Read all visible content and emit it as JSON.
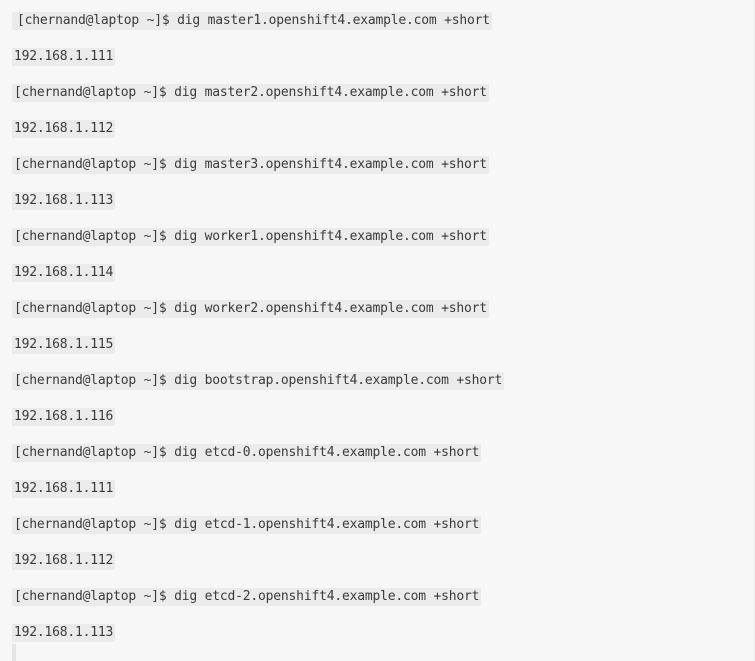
{
  "terminal": {
    "lines": [
      "[chernand@laptop ~]$ dig master1.openshift4.example.com +short",
      "192.168.1.111",
      "[chernand@laptop ~]$ dig master2.openshift4.example.com +short",
      "192.168.1.112",
      "[chernand@laptop ~]$ dig master3.openshift4.example.com +short",
      "192.168.1.113",
      "[chernand@laptop ~]$ dig worker1.openshift4.example.com +short",
      "192.168.1.114",
      "[chernand@laptop ~]$ dig worker2.openshift4.example.com +short",
      "192.168.1.115",
      "[chernand@laptop ~]$ dig bootstrap.openshift4.example.com +short",
      "192.168.1.116",
      "[chernand@laptop ~]$ dig etcd-0.openshift4.example.com +short",
      "192.168.1.111",
      "[chernand@laptop ~]$ dig etcd-1.openshift4.example.com +short",
      "192.168.1.112",
      "[chernand@laptop ~]$ dig etcd-2.openshift4.example.com +short",
      "192.168.1.113"
    ]
  }
}
